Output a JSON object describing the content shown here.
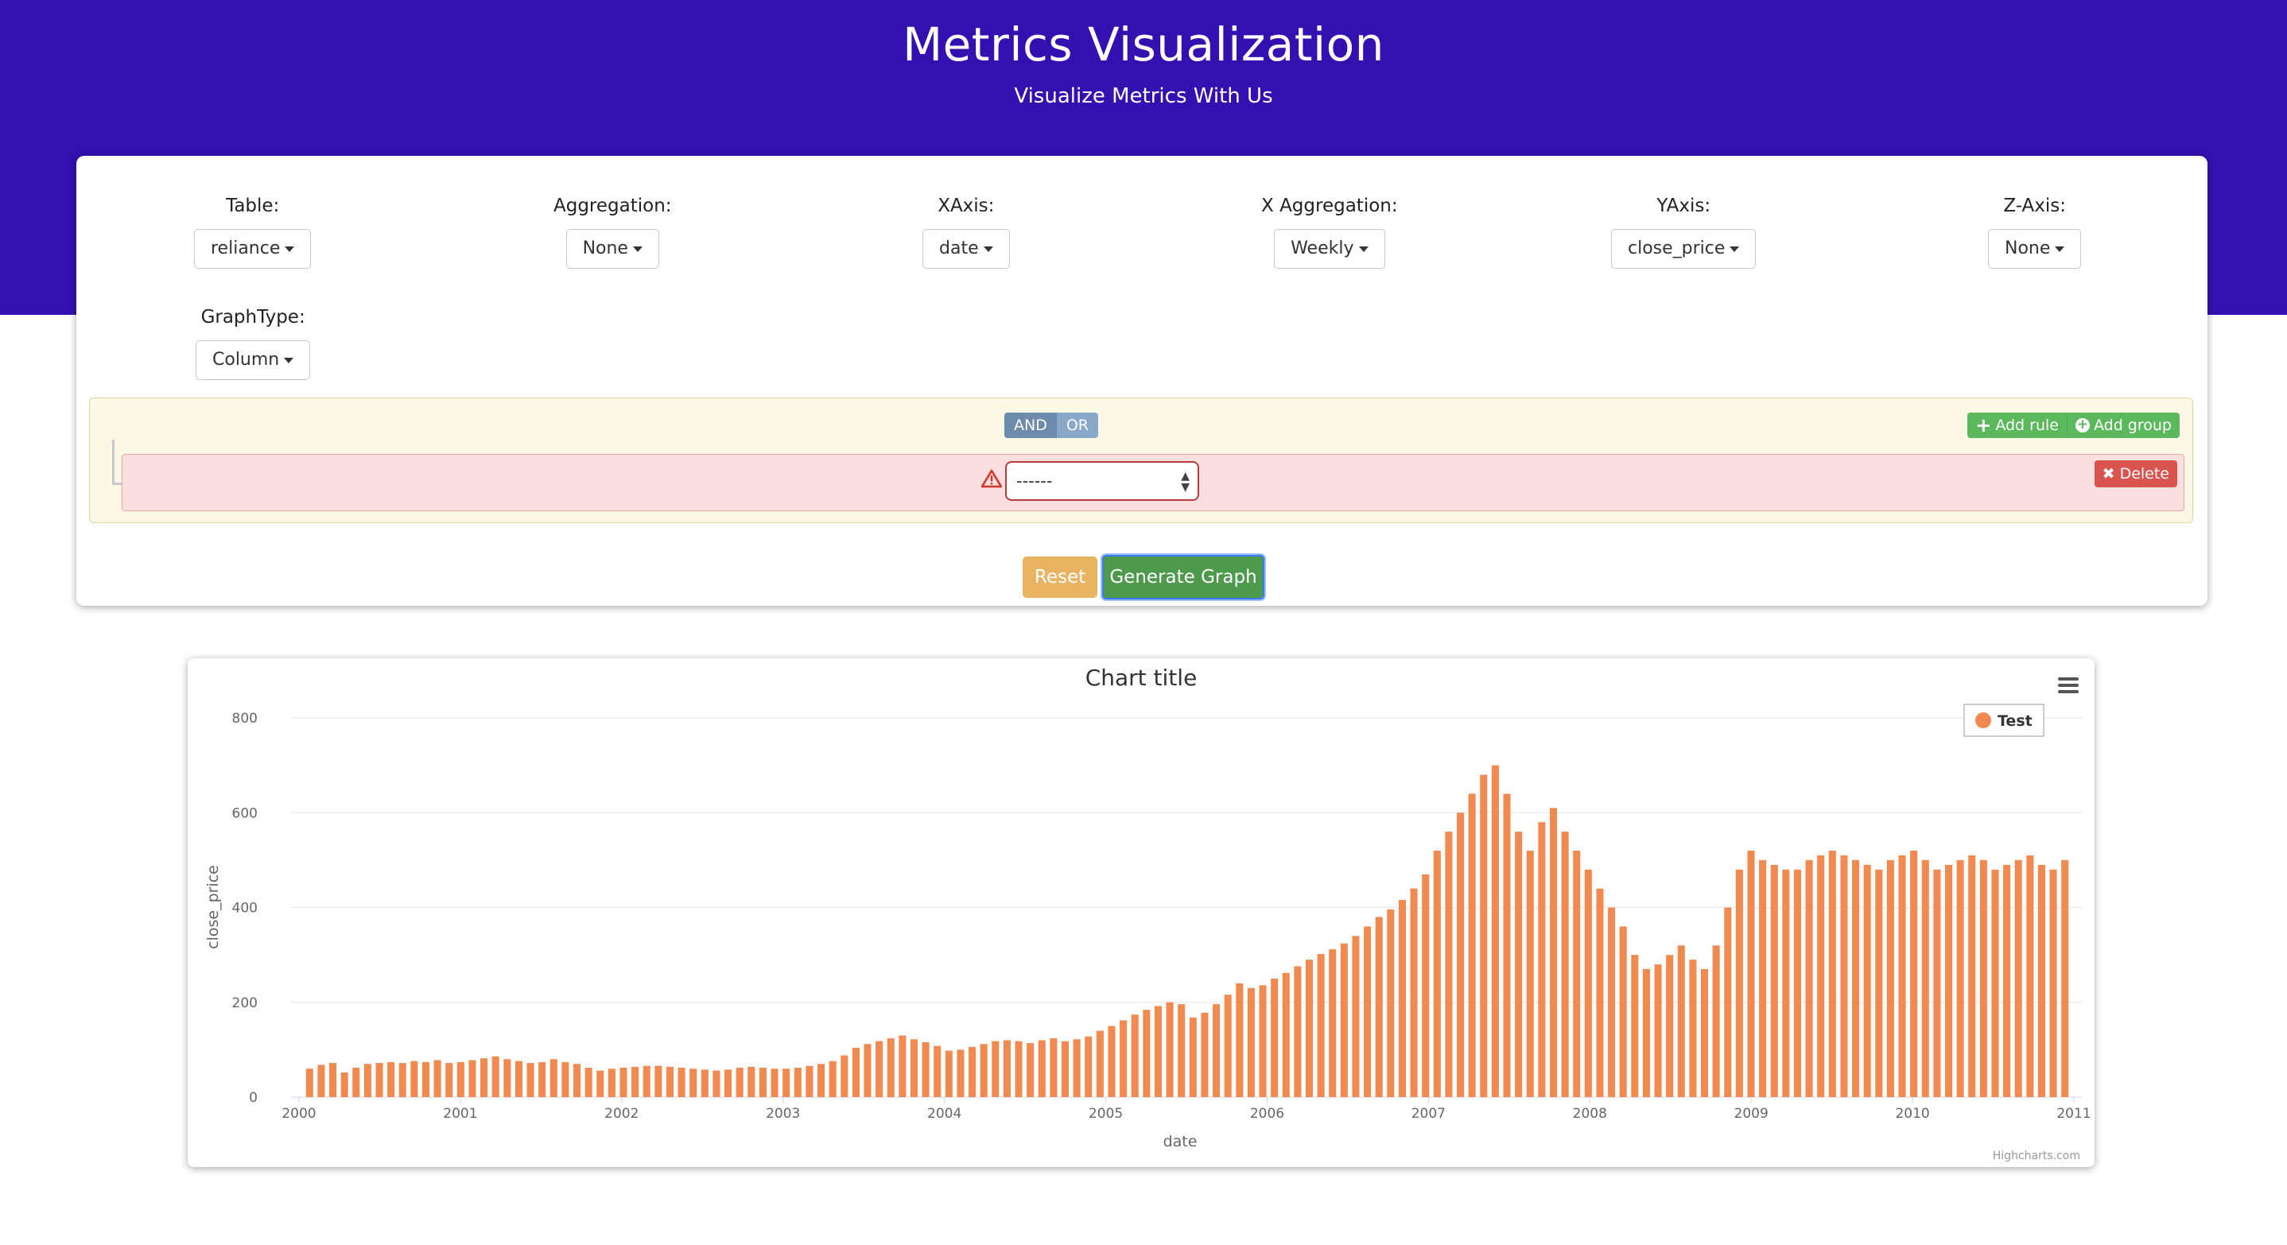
{
  "header": {
    "title": "Metrics Visualization",
    "subtitle": "Visualize Metrics With Us",
    "background_color": "#3311b0"
  },
  "controls": {
    "table": {
      "label": "Table:",
      "value": "reliance"
    },
    "aggregation": {
      "label": "Aggregation:",
      "value": "None"
    },
    "xaxis": {
      "label": "XAxis:",
      "value": "date"
    },
    "x_aggregation": {
      "label": "X Aggregation:",
      "value": "Weekly"
    },
    "yaxis": {
      "label": "YAxis:",
      "value": "close_price"
    },
    "zaxis": {
      "label": "Z-Axis:",
      "value": "None"
    },
    "graph_type": {
      "label": "GraphType:",
      "value": "Column"
    }
  },
  "query_builder": {
    "and_label": "AND",
    "or_label": "OR",
    "add_rule_label": "Add rule",
    "add_group_label": "Add group",
    "rule_select_value": "------",
    "delete_label": "Delete"
  },
  "buttons": {
    "reset_label": "Reset",
    "generate_label": "Generate Graph"
  },
  "chart_data": {
    "type": "bar",
    "title": "Chart title",
    "xlabel": "date",
    "ylabel": "close_price",
    "ylim": [
      0,
      800
    ],
    "yticks": [
      "0",
      "200",
      "400",
      "600",
      "800"
    ],
    "xticks": [
      "2000",
      "2001",
      "2002",
      "2003",
      "2004",
      "2005",
      "2006",
      "2007",
      "2008",
      "2009",
      "2010",
      "2011"
    ],
    "grid": true,
    "legend_position": "top-right",
    "credits": "Highcharts.com",
    "color": "#f08a50",
    "series": [
      {
        "name": "Test",
        "x_start": "2000-01",
        "interval": "monthly",
        "values": [
          60,
          68,
          72,
          52,
          62,
          70,
          72,
          74,
          72,
          76,
          74,
          78,
          72,
          74,
          78,
          82,
          86,
          80,
          76,
          72,
          74,
          80,
          74,
          70,
          62,
          56,
          60,
          62,
          64,
          66,
          66,
          64,
          62,
          60,
          58,
          56,
          58,
          62,
          64,
          62,
          60,
          60,
          62,
          66,
          70,
          76,
          88,
          104,
          112,
          118,
          124,
          130,
          122,
          116,
          108,
          98,
          100,
          106,
          112,
          118,
          120,
          118,
          114,
          120,
          124,
          118,
          122,
          128,
          140,
          150,
          162,
          174,
          184,
          192,
          200,
          196,
          168,
          178,
          196,
          216,
          240,
          230,
          236,
          250,
          262,
          276,
          290,
          302,
          312,
          324,
          340,
          360,
          380,
          396,
          416,
          440,
          470,
          520,
          560,
          600,
          640,
          680,
          700,
          640,
          560,
          520,
          580,
          610,
          560,
          520,
          480,
          440,
          400,
          360,
          300,
          270,
          280,
          300,
          320,
          290,
          270,
          320,
          400,
          480,
          520,
          500,
          490,
          480,
          480,
          500,
          510,
          520,
          510,
          500,
          490,
          480,
          500,
          510,
          520,
          500,
          480,
          490,
          500,
          510,
          500,
          480,
          490,
          500,
          510,
          490,
          480,
          500
        ],
        "x_end": "2011-01"
      }
    ]
  }
}
